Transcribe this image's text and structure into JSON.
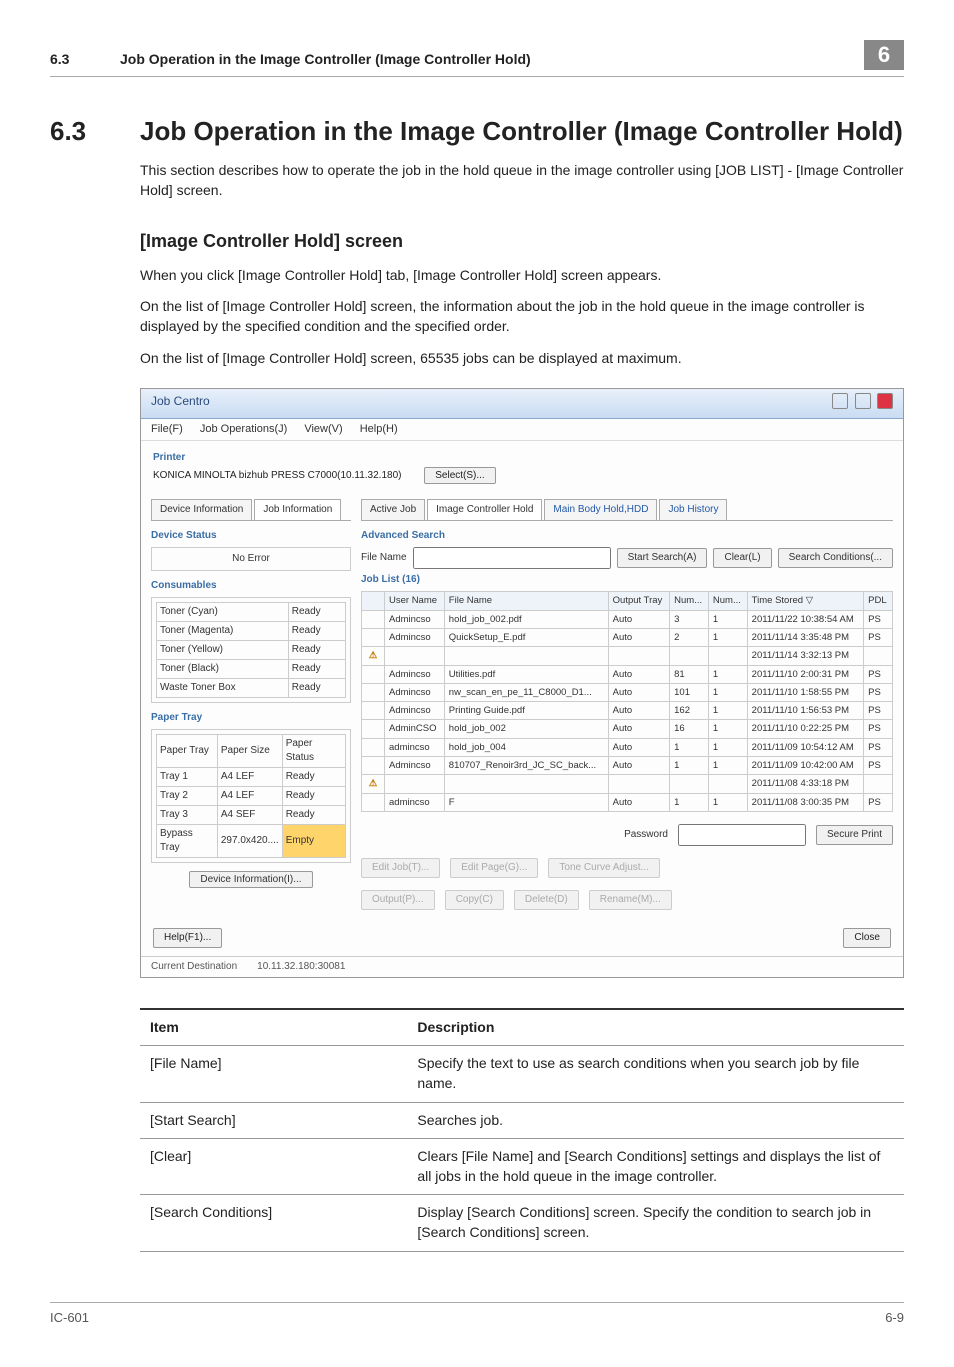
{
  "header": {
    "sec_num": "6.3",
    "sec_title": "Job Operation in the Image Controller (Image Controller Hold)",
    "chapter": "6"
  },
  "h1": {
    "num": "6.3",
    "title": "Job Operation in the Image Controller (Image Controller Hold)"
  },
  "intro": "This section describes how to operate the job in the hold queue in the image controller using [JOB LIST] - [Image Controller Hold] screen.",
  "h2": "[Image Controller Hold] screen",
  "p1": "When you click [Image Controller Hold] tab, [Image Controller Hold] screen appears.",
  "p2": "On the list of [Image Controller Hold] screen, the information about the job in the hold queue in the image controller is displayed by the specified condition and the specified order.",
  "p3": "On the list of [Image Controller Hold] screen, 65535 jobs can be displayed at maximum.",
  "app": {
    "title": "Job Centro",
    "menu": {
      "file": "File(F)",
      "jobops": "Job Operations(J)",
      "view": "View(V)",
      "help": "Help(H)"
    },
    "printer_label": "Printer",
    "printer_name": "KONICA MINOLTA bizhub PRESS C7000(10.11.32.180)",
    "select_btn": "Select(S)...",
    "left_tabs": {
      "device": "Device Information",
      "job": "Job Information"
    },
    "device_status_label": "Device Status",
    "device_status_value": "No Error",
    "consumables_label": "Consumables",
    "toners": [
      {
        "n": "Toner (Cyan)",
        "s": "Ready"
      },
      {
        "n": "Toner (Magenta)",
        "s": "Ready"
      },
      {
        "n": "Toner (Yellow)",
        "s": "Ready"
      },
      {
        "n": "Toner (Black)",
        "s": "Ready"
      },
      {
        "n": "Waste Toner Box",
        "s": "Ready"
      }
    ],
    "paper_tray_label": "Paper Tray",
    "tray_head": {
      "c1": "Paper Tray",
      "c2": "Paper Size",
      "c3": "Paper Status"
    },
    "trays": [
      {
        "t": "Tray 1",
        "sz": "A4 LEF",
        "st": "Ready"
      },
      {
        "t": "Tray 2",
        "sz": "A4 LEF",
        "st": "Ready"
      },
      {
        "t": "Tray 3",
        "sz": "A4 SEF",
        "st": "Ready"
      },
      {
        "t": "Bypass Tray",
        "sz": "297.0x420....",
        "st": "Empty",
        "hl": true
      }
    ],
    "device_info_btn": "Device Information(I)...",
    "right_tabs": {
      "active": "Active Job",
      "hold": "Image Controller Hold",
      "main": "Main Body Hold,HDD",
      "hist": "Job History"
    },
    "adv_search": "Advanced Search",
    "file_name_label": "File Name",
    "start_search": "Start Search(A)",
    "clear": "Clear(L)",
    "search_cond": "Search Conditions(...",
    "job_list_label": "Job List (16)",
    "cols": {
      "user": "User Name",
      "file": "File Name",
      "out": "Output Tray",
      "num1": "Num...",
      "num2": "Num...",
      "time": "Time Stored ▽",
      "pdl": "PDL"
    },
    "rows": [
      {
        "u": "Admincso",
        "f": "hold_job_002.pdf",
        "o": "Auto",
        "n1": "3",
        "n2": "1",
        "t": "2011/11/22 10:38:54 AM",
        "p": "PS"
      },
      {
        "u": "Admincso",
        "f": "QuickSetup_E.pdf",
        "o": "Auto",
        "n1": "2",
        "n2": "1",
        "t": "2011/11/14 3:35:48 PM",
        "p": "PS"
      },
      {
        "w": true,
        "t": "2011/11/14 3:32:13 PM"
      },
      {
        "u": "Admincso",
        "f": "Utilities.pdf",
        "o": "Auto",
        "n1": "81",
        "n2": "1",
        "t": "2011/11/10 2:00:31 PM",
        "p": "PS"
      },
      {
        "u": "Admincso",
        "f": "nw_scan_en_pe_11_C8000_D1...",
        "o": "Auto",
        "n1": "101",
        "n2": "1",
        "t": "2011/11/10 1:58:55 PM",
        "p": "PS"
      },
      {
        "u": "Admincso",
        "f": "Printing Guide.pdf",
        "o": "Auto",
        "n1": "162",
        "n2": "1",
        "t": "2011/11/10 1:56:53 PM",
        "p": "PS"
      },
      {
        "u": "AdminCSO",
        "f": "hold_job_002",
        "o": "Auto",
        "n1": "16",
        "n2": "1",
        "t": "2011/11/10 0:22:25 PM",
        "p": "PS"
      },
      {
        "u": "admincso",
        "f": "hold_job_004",
        "o": "Auto",
        "n1": "1",
        "n2": "1",
        "t": "2011/11/09 10:54:12 AM",
        "p": "PS"
      },
      {
        "u": "Admincso",
        "f": "810707_Renoir3rd_JC_SC_back...",
        "o": "Auto",
        "n1": "1",
        "n2": "1",
        "t": "2011/11/09 10:42:00 AM",
        "p": "PS"
      },
      {
        "w": true,
        "t": "2011/11/08 4:33:18 PM"
      },
      {
        "u": "admincso",
        "f": "F",
        "o": "Auto",
        "n1": "1",
        "n2": "1",
        "t": "2011/11/08 3:00:35 PM",
        "p": "PS"
      }
    ],
    "password_label": "Password",
    "secure_print": "Secure Print",
    "btns": {
      "edit_job": "Edit Job(T)...",
      "edit_page": "Edit Page(G)...",
      "tone": "Tone Curve Adjust...",
      "output": "Output(P)...",
      "copy": "Copy(C)",
      "delete": "Delete(D)",
      "rename": "Rename(M)..."
    },
    "help_btn": "Help(F1)...",
    "close_btn": "Close",
    "status1": "Current Destination",
    "status2": "10.11.32.180:30081"
  },
  "table": {
    "head_item": "Item",
    "head_desc": "Description",
    "rows": [
      {
        "item": "[File Name]",
        "desc": "Specify the text to use as search conditions when you search job by file name."
      },
      {
        "item": "[Start Search]",
        "desc": "Searches job."
      },
      {
        "item": "[Clear]",
        "desc": "Clears [File Name] and [Search Conditions] settings and displays the list of all jobs in the hold queue in the image controller."
      },
      {
        "item": "[Search Conditions]",
        "desc": "Display [Search Conditions] screen. Specify the condition to search job in [Search Conditions] screen."
      }
    ]
  },
  "footer": {
    "left": "IC-601",
    "right": "6-9"
  }
}
